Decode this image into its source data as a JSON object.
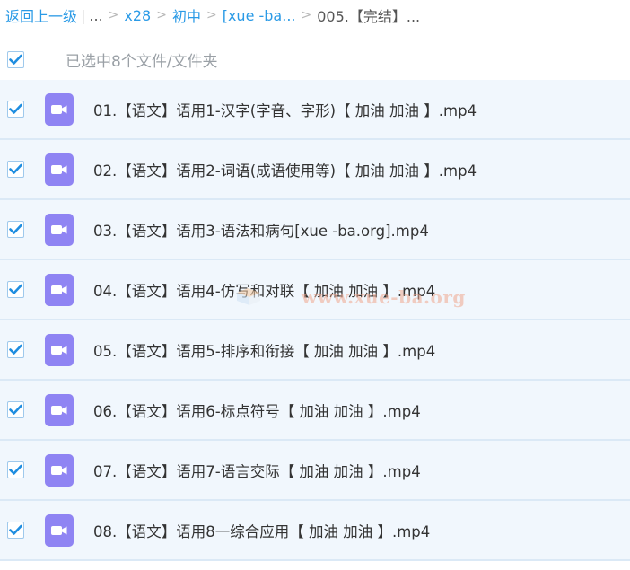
{
  "breadcrumb": {
    "back": "返回上一级",
    "divider": "|",
    "ellipsis": "...",
    "sep": ">",
    "items": [
      "x28",
      "初中",
      "[xue -ba...",
      "005.【完结】..."
    ]
  },
  "selection": {
    "label": "已选中8个文件/文件夹",
    "checked": true
  },
  "files": [
    {
      "name": "01.【语文】语用1-汉字(字音、字形)【 加油 加油 】.mp4",
      "checked": true,
      "icon": "video-file-icon"
    },
    {
      "name": "02.【语文】语用2-词语(成语使用等)【 加油 加油 】.mp4",
      "checked": true,
      "icon": "video-file-icon"
    },
    {
      "name": "03.【语文】语用3-语法和病句[xue -ba.org].mp4",
      "checked": true,
      "icon": "video-file-icon"
    },
    {
      "name": "04.【语文】语用4-仿写和对联【 加油 加油 】.mp4",
      "checked": true,
      "icon": "video-file-icon"
    },
    {
      "name": "05.【语文】语用5-排序和衔接【 加油 加油 】.mp4",
      "checked": true,
      "icon": "video-file-icon"
    },
    {
      "name": "06.【语文】语用6-标点符号【 加油 加油 】.mp4",
      "checked": true,
      "icon": "video-file-icon"
    },
    {
      "name": "07.【语文】语用7-语言交际【 加油 加油 】.mp4",
      "checked": true,
      "icon": "video-file-icon"
    },
    {
      "name": "08.【语文】语用8一综合应用【 加油 加油 】.mp4",
      "checked": true,
      "icon": "video-file-icon"
    }
  ],
  "watermark": {
    "text": "www.xue-ba.org"
  },
  "colors": {
    "link": "#2a9ae6",
    "row_bg": "#f1f7fd",
    "row_border": "#dbe9f6",
    "check": "#1e8de0",
    "video_icon": "#8f84f3"
  }
}
